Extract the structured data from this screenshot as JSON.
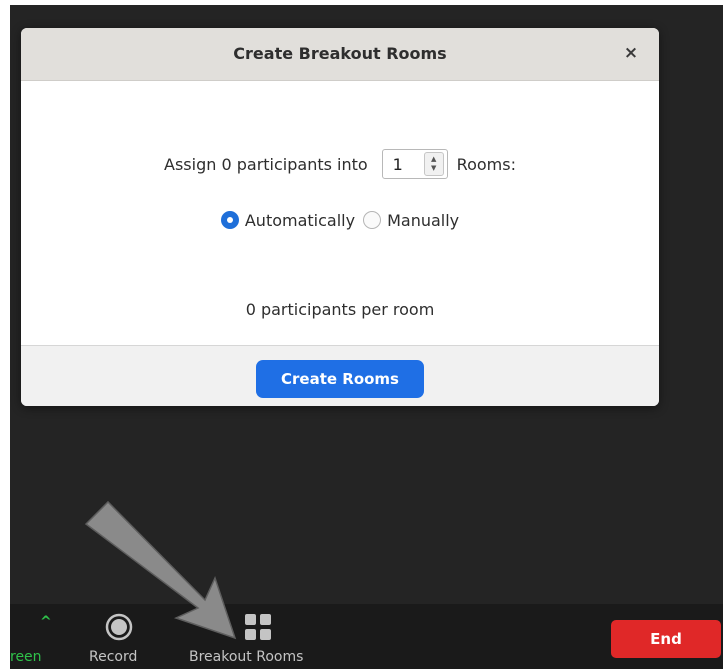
{
  "dialog": {
    "title": "Create Breakout Rooms",
    "close_icon": "×",
    "assign_prefix": "Assign 0 participants into",
    "rooms_count": "1",
    "rooms_suffix": "Rooms:",
    "option_auto": "Automatically",
    "option_manual": "Manually",
    "selected_option": "Automatically",
    "per_room_text": "0 participants per room",
    "create_button": "Create Rooms"
  },
  "toolbar": {
    "share_label_partial": "reen",
    "record_label": "Record",
    "breakout_label": "Breakout Rooms",
    "end_label": "End"
  },
  "colors": {
    "accent": "#1f6fe5",
    "end": "#e02828",
    "share_green": "#2fc24a",
    "background": "#242424"
  }
}
